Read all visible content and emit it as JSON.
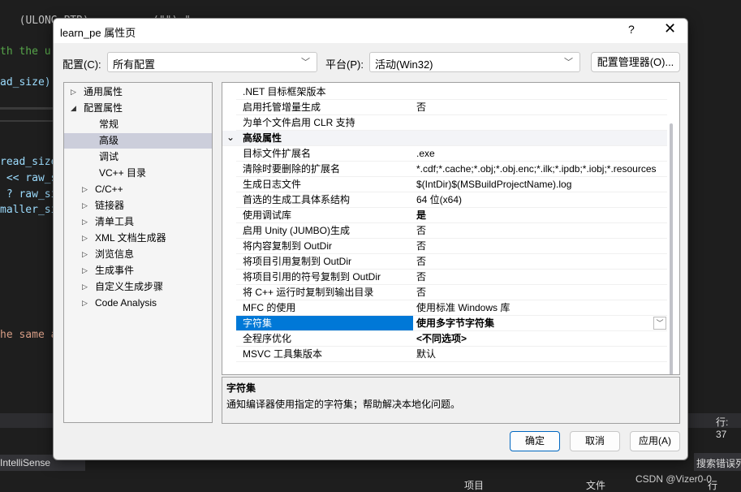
{
  "background": {
    "code_lines": [
      "  (ULONG_PTR)          (\"\") \"",
      "th the u",
      "ad_size)",
      "read_size",
      " << raw_s",
      " ? raw_si",
      "maller_si",
      "he same a"
    ],
    "status_line": "行: 37",
    "intellisense": "IntelliSense",
    "search_errors": "搜索错误列",
    "col_project": "项目",
    "col_file": "文件",
    "col_line": "行",
    "watermark": "CSDN @Vizer0-0"
  },
  "dialog": {
    "title": "learn_pe 属性页",
    "help_label": "?",
    "config_label": "配置(C):",
    "config_value": "所有配置",
    "platform_label": "平台(P):",
    "platform_value": "活动(Win32)",
    "config_manager": "配置管理器(O)...",
    "tree": [
      {
        "label": "通用属性",
        "indent": 0,
        "expander": "collapsed"
      },
      {
        "label": "配置属性",
        "indent": 0,
        "expander": "expanded"
      },
      {
        "label": "常规",
        "indent": 2
      },
      {
        "label": "高级",
        "indent": 2,
        "selected": true
      },
      {
        "label": "调试",
        "indent": 2
      },
      {
        "label": "VC++ 目录",
        "indent": 2
      },
      {
        "label": "C/C++",
        "indent": 1,
        "expander": "collapsed"
      },
      {
        "label": "链接器",
        "indent": 1,
        "expander": "collapsed"
      },
      {
        "label": "清单工具",
        "indent": 1,
        "expander": "collapsed"
      },
      {
        "label": "XML 文档生成器",
        "indent": 1,
        "expander": "collapsed"
      },
      {
        "label": "浏览信息",
        "indent": 1,
        "expander": "collapsed"
      },
      {
        "label": "生成事件",
        "indent": 1,
        "expander": "collapsed"
      },
      {
        "label": "自定义生成步骤",
        "indent": 1,
        "expander": "collapsed"
      },
      {
        "label": "Code Analysis",
        "indent": 1,
        "expander": "collapsed"
      }
    ],
    "properties": [
      {
        "name": ".NET 目标框架版本",
        "value": ""
      },
      {
        "name": "启用托管增量生成",
        "value": "否"
      },
      {
        "name": "为单个文件启用 CLR 支持",
        "value": ""
      },
      {
        "name": "高级属性",
        "category": true
      },
      {
        "name": "目标文件扩展名",
        "value": ".exe"
      },
      {
        "name": "清除时要删除的扩展名",
        "value": "*.cdf;*.cache;*.obj;*.obj.enc;*.ilk;*.ipdb;*.iobj;*.resources"
      },
      {
        "name": "生成日志文件",
        "value": "$(IntDir)$(MSBuildProjectName).log"
      },
      {
        "name": "首选的生成工具体系结构",
        "value": "64 位(x64)"
      },
      {
        "name": "使用调试库",
        "value": "是",
        "bold": true
      },
      {
        "name": "启用 Unity (JUMBO)生成",
        "value": "否"
      },
      {
        "name": "将内容复制到 OutDir",
        "value": "否"
      },
      {
        "name": "将项目引用复制到 OutDir",
        "value": "否"
      },
      {
        "name": "将项目引用的符号复制到 OutDir",
        "value": "否"
      },
      {
        "name": "将 C++ 运行时复制到输出目录",
        "value": "否"
      },
      {
        "name": "MFC 的使用",
        "value": "使用标准 Windows 库"
      },
      {
        "name": "字符集",
        "value": "使用多字节字符集",
        "bold": true,
        "selected": true
      },
      {
        "name": "全程序优化",
        "value": "<不同选项>",
        "bold": true
      },
      {
        "name": "MSVC 工具集版本",
        "value": "默认"
      }
    ],
    "description": {
      "title": "字符集",
      "text": "通知编译器使用指定的字符集；帮助解决本地化问题。"
    },
    "ok": "确定",
    "cancel": "取消",
    "apply": "应用(A)"
  }
}
